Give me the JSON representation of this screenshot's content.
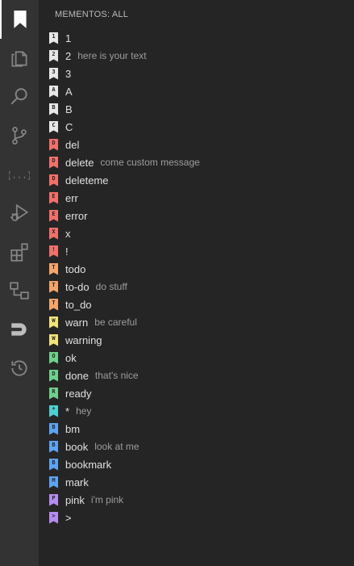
{
  "sidebar": {
    "title": "MEMENTOS: ALL"
  },
  "activity": [
    {
      "name": "mementos-bookmark-icon",
      "active": true
    },
    {
      "name": "explorer-icon"
    },
    {
      "name": "search-icon"
    },
    {
      "name": "source-control-icon"
    },
    {
      "name": "json-braces-icon"
    },
    {
      "name": "run-debug-icon"
    },
    {
      "name": "extensions-icon"
    },
    {
      "name": "remote-explorer-icon"
    },
    {
      "name": "magnet-icon"
    },
    {
      "name": "timeline-history-icon"
    }
  ],
  "items": [
    {
      "glyph": "1",
      "label": "1",
      "message": "",
      "color": "#e6e6e6"
    },
    {
      "glyph": "2",
      "label": "2",
      "message": "here is your text",
      "color": "#e6e6e6"
    },
    {
      "glyph": "3",
      "label": "3",
      "message": "",
      "color": "#e6e6e6"
    },
    {
      "glyph": "A",
      "label": "A",
      "message": "",
      "color": "#e6e6e6"
    },
    {
      "glyph": "B",
      "label": "B",
      "message": "",
      "color": "#e6e6e6"
    },
    {
      "glyph": "C",
      "label": "C",
      "message": "",
      "color": "#e6e6e6"
    },
    {
      "glyph": "D",
      "label": "del",
      "message": "",
      "color": "#f0706a"
    },
    {
      "glyph": "D",
      "label": "delete",
      "message": "come custom message",
      "color": "#f0706a"
    },
    {
      "glyph": "D",
      "label": "deleteme",
      "message": "",
      "color": "#f0706a"
    },
    {
      "glyph": "E",
      "label": "err",
      "message": "",
      "color": "#f0706a"
    },
    {
      "glyph": "E",
      "label": "error",
      "message": "",
      "color": "#f0706a"
    },
    {
      "glyph": "X",
      "label": "x",
      "message": "",
      "color": "#f0706a"
    },
    {
      "glyph": "!",
      "label": "!",
      "message": "",
      "color": "#f0706a"
    },
    {
      "glyph": "T",
      "label": "todo",
      "message": "",
      "color": "#f3a56b"
    },
    {
      "glyph": "T",
      "label": "to-do",
      "message": "do stuff",
      "color": "#f3a56b"
    },
    {
      "glyph": "T",
      "label": "to_do",
      "message": "",
      "color": "#f3a56b"
    },
    {
      "glyph": "W",
      "label": "warn",
      "message": "be careful",
      "color": "#f1e27a"
    },
    {
      "glyph": "W",
      "label": "warning",
      "message": "",
      "color": "#f1e27a"
    },
    {
      "glyph": "O",
      "label": "ok",
      "message": "",
      "color": "#6fd08c"
    },
    {
      "glyph": "D",
      "label": "done",
      "message": "that's nice",
      "color": "#6fd08c"
    },
    {
      "glyph": "R",
      "label": "ready",
      "message": "",
      "color": "#6fd08c"
    },
    {
      "glyph": "*",
      "label": "*",
      "message": "hey",
      "color": "#4fcfd1"
    },
    {
      "glyph": "B",
      "label": "bm",
      "message": "",
      "color": "#5ea3f0"
    },
    {
      "glyph": "B",
      "label": "book",
      "message": "look at me",
      "color": "#5ea3f0"
    },
    {
      "glyph": "B",
      "label": "bookmark",
      "message": "",
      "color": "#5ea3f0"
    },
    {
      "glyph": "M",
      "label": "mark",
      "message": "",
      "color": "#5ea3f0"
    },
    {
      "glyph": "P",
      "label": "pink",
      "message": "i'm pink",
      "color": "#b58cf0"
    },
    {
      "glyph": ">",
      "label": ">",
      "message": "",
      "color": "#b58cf0"
    }
  ]
}
